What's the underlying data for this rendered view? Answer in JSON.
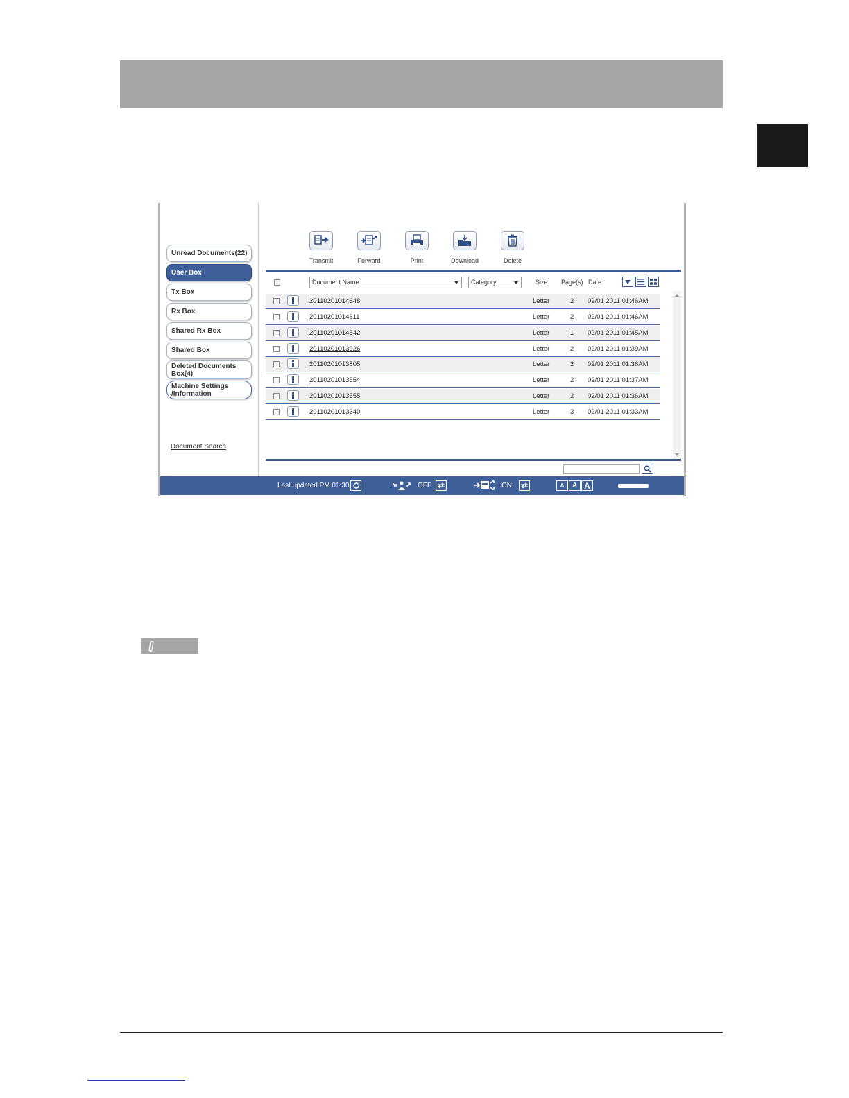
{
  "sidebar": {
    "items": [
      {
        "label": "Unread Documents(22)",
        "active": false
      },
      {
        "label": "User Box",
        "active": true
      },
      {
        "label": "Tx Box",
        "active": false
      },
      {
        "label": "Rx Box",
        "active": false
      },
      {
        "label": "Shared Rx Box",
        "active": false
      },
      {
        "label": "Shared Box",
        "active": false
      },
      {
        "label_line1": "Deleted Documents",
        "label_line2": "Box(4)",
        "active": false
      },
      {
        "label_line1": "Machine Settings",
        "label_line2": "/Information",
        "active": false
      }
    ],
    "document_search": "Document Search"
  },
  "toolbar": {
    "transmit": "Transmit",
    "forward": "Forward",
    "print": "Print",
    "download": "Download",
    "delete": "Delete"
  },
  "table": {
    "name_select": "Document Name",
    "category_select": "Category",
    "columns": {
      "size": "Size",
      "pages": "Page(s)",
      "date": "Date"
    },
    "rows": [
      {
        "name": "20110201014648",
        "size": "Letter",
        "pages": "2",
        "date": "02/01 2011 01:46AM"
      },
      {
        "name": "20110201014611",
        "size": "Letter",
        "pages": "2",
        "date": "02/01 2011 01:46AM"
      },
      {
        "name": "20110201014542",
        "size": "Letter",
        "pages": "1",
        "date": "02/01 2011 01:45AM"
      },
      {
        "name": "20110201013926",
        "size": "Letter",
        "pages": "2",
        "date": "02/01 2011 01:39AM"
      },
      {
        "name": "20110201013805",
        "size": "Letter",
        "pages": "2",
        "date": "02/01 2011 01:38AM"
      },
      {
        "name": "20110201013654",
        "size": "Letter",
        "pages": "2",
        "date": "02/01 2011 01:37AM"
      },
      {
        "name": "20110201013555",
        "size": "Letter",
        "pages": "2",
        "date": "02/01 2011 01:36AM"
      },
      {
        "name": "20110201013340",
        "size": "Letter",
        "pages": "3",
        "date": "02/01 2011 01:33AM"
      }
    ]
  },
  "statusbar": {
    "last_updated": "Last updated PM 01:30",
    "off_label": "OFF",
    "on_label": "ON",
    "font_small": "A",
    "font_medium": "A",
    "font_large": "A"
  },
  "colors": {
    "accent": "#3e5f98",
    "header_gray": "#a6a6a6",
    "tab_black": "#1a1a1a"
  }
}
